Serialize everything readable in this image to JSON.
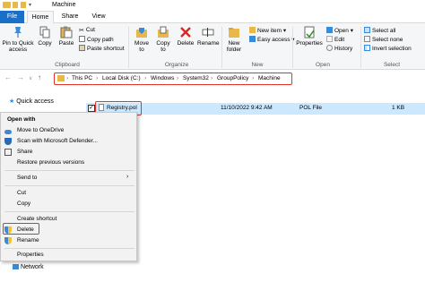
{
  "window": {
    "title": "Machine"
  },
  "tabs": [
    "File",
    "Home",
    "Share",
    "View"
  ],
  "ribbon": {
    "clipboard": {
      "pin_label": "Pin to Quick access",
      "copy_label": "Copy",
      "paste_label": "Paste",
      "cut_label": "Cut",
      "copy_path_label": "Copy path",
      "paste_shortcut_label": "Paste shortcut",
      "group_label": "Clipboard"
    },
    "organize": {
      "move_to_label": "Move to",
      "copy_to_label": "Copy to",
      "delete_label": "Delete",
      "rename_label": "Rename",
      "group_label": "Organize"
    },
    "new": {
      "new_folder_label": "New folder",
      "new_item_label": "New item",
      "easy_access_label": "Easy access",
      "group_label": "New"
    },
    "open": {
      "properties_label": "Properties",
      "open_label": "Open",
      "edit_label": "Edit",
      "history_label": "History",
      "group_label": "Open"
    },
    "select": {
      "select_all_label": "Select all",
      "select_none_label": "Select none",
      "invert_selection_label": "Invert selection",
      "group_label": "Select"
    }
  },
  "address": {
    "crumbs": [
      "This PC",
      "Local Disk (C:)",
      "Windows",
      "System32",
      "GroupPolicy",
      "Machine"
    ]
  },
  "nav": {
    "quick_access": "Quick access",
    "network": "Network"
  },
  "file": {
    "name": "Registry.pol",
    "date": "11/10/2022 9:42 AM",
    "type": "POL File",
    "size": "1 KB"
  },
  "context_menu": {
    "open_with": "Open with",
    "move_to_onedrive": "Move to OneDrive",
    "scan": "Scan with Microsoft Defender...",
    "share": "Share",
    "restore": "Restore previous versions",
    "send_to": "Send to",
    "cut": "Cut",
    "copy": "Copy",
    "create_shortcut": "Create shortcut",
    "delete": "Delete",
    "rename": "Rename",
    "properties": "Properties"
  },
  "colors": {
    "accent": "#1a6fc9",
    "highlight": "#e0332b",
    "selection": "#cce8ff"
  }
}
